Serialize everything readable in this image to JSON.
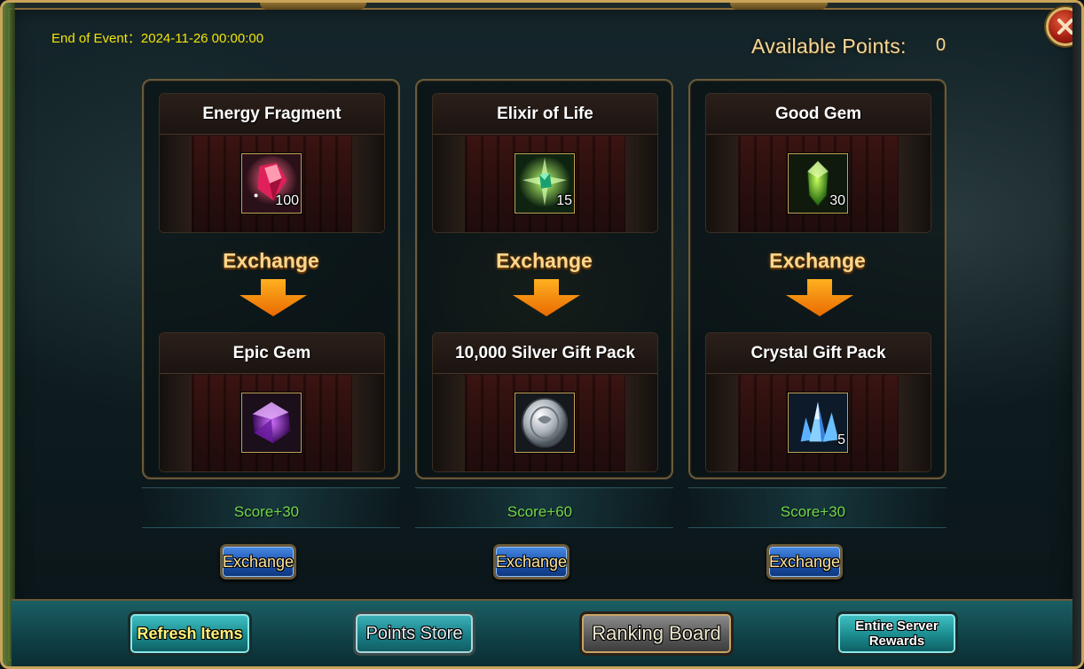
{
  "header": {
    "event_end": "End of Event：2024-11-26 00:00:00",
    "points_label": "Available Points:",
    "points_value": "0"
  },
  "exchanges": [
    {
      "cost": {
        "name": "Energy Fragment",
        "qty": "100",
        "icon": "energy-fragment-icon"
      },
      "exchange_label": "Exchange",
      "reward": {
        "name": "Epic Gem",
        "qty": "",
        "icon": "epic-gem-icon"
      },
      "score": "Score+30",
      "button": "Exchange"
    },
    {
      "cost": {
        "name": "Elixir of Life",
        "qty": "15",
        "icon": "elixir-of-life-icon"
      },
      "exchange_label": "Exchange",
      "reward": {
        "name": "10,000 Silver Gift Pack",
        "qty": "",
        "icon": "silver-coin-icon"
      },
      "score": "Score+60",
      "button": "Exchange"
    },
    {
      "cost": {
        "name": "Good Gem",
        "qty": "30",
        "icon": "good-gem-icon"
      },
      "exchange_label": "Exchange",
      "reward": {
        "name": "Crystal Gift Pack",
        "qty": "5",
        "icon": "crystal-icon"
      },
      "score": "Score+30",
      "button": "Exchange"
    }
  ],
  "footer": {
    "refresh": "Refresh Items",
    "store": "Points Store",
    "ranking": "Ranking Board",
    "server_line1": "Entire Server",
    "server_line2": "Rewards"
  },
  "colors": {
    "score_green": "#73d64a",
    "event_yellow": "#f1e30a",
    "points_gold": "#f2d79a",
    "exchange_orange": "#fdd78c"
  }
}
